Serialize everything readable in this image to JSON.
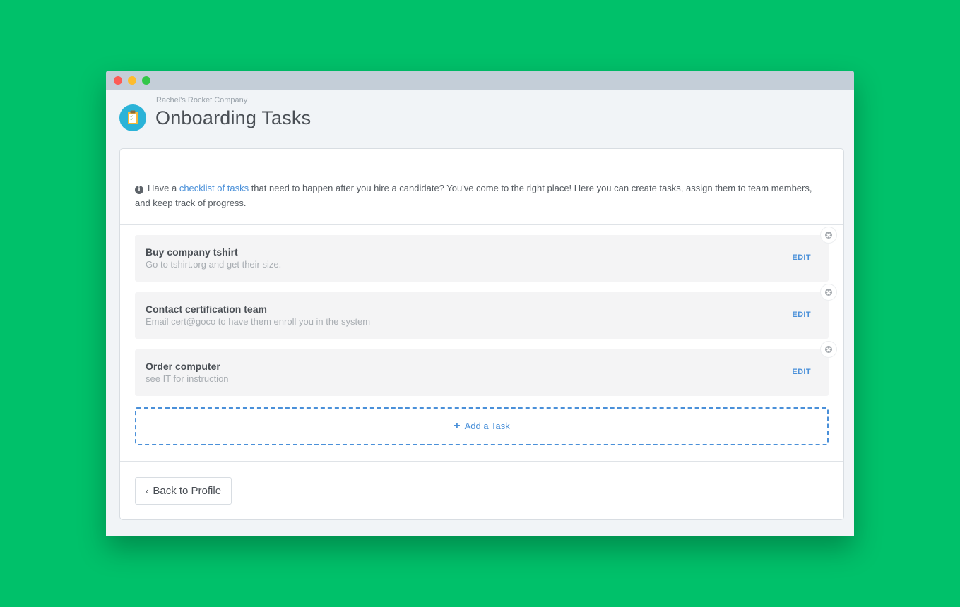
{
  "header": {
    "company": "Rachel's Rocket Company",
    "title": "Onboarding Tasks"
  },
  "intro": {
    "before_link": "Have a ",
    "link": "checklist of tasks",
    "after_link": " that need to happen after you hire a candidate? You've come to the right place! Here you can create tasks, assign them to team members, and keep track of progress."
  },
  "tasks": [
    {
      "title": "Buy company tshirt",
      "description": "Go to tshirt.org and get their size.",
      "edit_label": "EDIT"
    },
    {
      "title": "Contact certification team",
      "description": "Email cert@goco to have them enroll you in the system",
      "edit_label": "EDIT"
    },
    {
      "title": "Order computer",
      "description": "see IT for instruction",
      "edit_label": "EDIT"
    }
  ],
  "add_task": {
    "icon": "+",
    "label": "Add a Task"
  },
  "footer": {
    "back_icon": "‹",
    "back_label": "Back to Profile"
  },
  "colors": {
    "background": "#00c16a",
    "accent": "#4a90d9",
    "app_icon": "#2bb3d8"
  }
}
